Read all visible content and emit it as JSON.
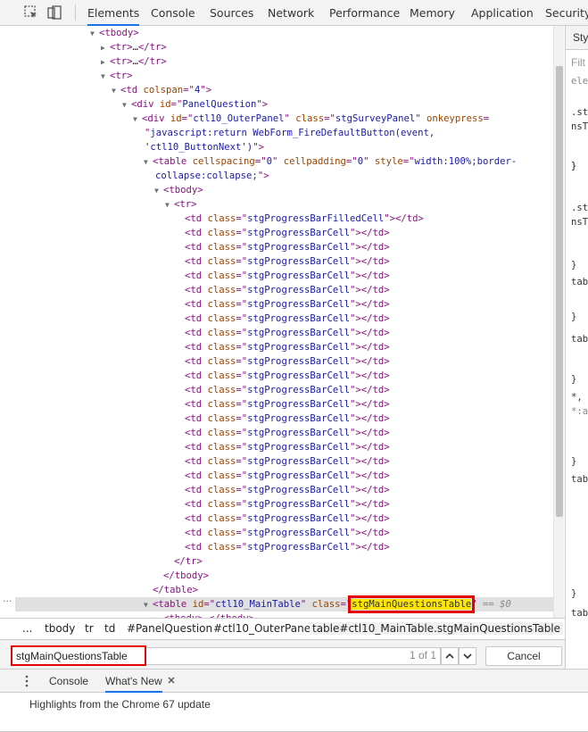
{
  "topbar": {
    "tabs": [
      "Elements",
      "Console",
      "Sources",
      "Network",
      "Performance",
      "Memory",
      "Application",
      "Security"
    ],
    "active_tab": "Elements"
  },
  "tree": {
    "lines": [
      {
        "indent": 7,
        "arrow": "open",
        "html": [
          [
            "t",
            "<tbody>"
          ]
        ]
      },
      {
        "indent": 8,
        "arrow": "closed",
        "html": [
          [
            "t",
            "<tr>"
          ],
          [
            "tx",
            "…"
          ],
          [
            "t",
            "</tr>"
          ]
        ]
      },
      {
        "indent": 8,
        "arrow": "closed",
        "html": [
          [
            "t",
            "<tr>"
          ],
          [
            "tx",
            "…"
          ],
          [
            "t",
            "</tr>"
          ]
        ]
      },
      {
        "indent": 8,
        "arrow": "open",
        "html": [
          [
            "t",
            "<tr>"
          ]
        ]
      },
      {
        "indent": 9,
        "arrow": "open",
        "html": [
          [
            "t",
            "<td "
          ],
          [
            "an",
            "colspan"
          ],
          [
            "t",
            "=\""
          ],
          [
            "av",
            "4"
          ],
          [
            "t",
            "\">"
          ]
        ]
      },
      {
        "indent": 10,
        "arrow": "open",
        "html": [
          [
            "t",
            "<div "
          ],
          [
            "an",
            "id"
          ],
          [
            "t",
            "=\""
          ],
          [
            "av",
            "PanelQuestion"
          ],
          [
            "t",
            "\">"
          ]
        ]
      },
      {
        "indent": 11,
        "arrow": "open",
        "html": [
          [
            "t",
            "<div "
          ],
          [
            "an",
            "id"
          ],
          [
            "t",
            "=\""
          ],
          [
            "av",
            "ctl10_OuterPanel"
          ],
          [
            "t",
            "\" "
          ],
          [
            "an",
            "class"
          ],
          [
            "t",
            "=\""
          ],
          [
            "av",
            "stgSurveyPanel"
          ],
          [
            "t",
            "\" "
          ],
          [
            "an",
            "onkeypress"
          ],
          [
            "t",
            "="
          ]
        ]
      },
      {
        "indent": 11,
        "arrow": "none",
        "cont": 1,
        "html": [
          [
            "t",
            "\""
          ],
          [
            "av",
            "javascript:return WebForm_FireDefaultButton(event,"
          ]
        ]
      },
      {
        "indent": 11,
        "arrow": "none",
        "cont": 1,
        "html": [
          [
            "av",
            "'ctl10_ButtonNext')"
          ],
          [
            "t",
            "\">"
          ]
        ]
      },
      {
        "indent": 12,
        "arrow": "open",
        "html": [
          [
            "t",
            "<table "
          ],
          [
            "an",
            "cellspacing"
          ],
          [
            "t",
            "=\""
          ],
          [
            "av",
            "0"
          ],
          [
            "t",
            "\" "
          ],
          [
            "an",
            "cellpadding"
          ],
          [
            "t",
            "=\""
          ],
          [
            "av",
            "0"
          ],
          [
            "t",
            "\" "
          ],
          [
            "an",
            "style"
          ],
          [
            "t",
            "=\""
          ],
          [
            "av",
            "width:100%;border-"
          ]
        ]
      },
      {
        "indent": 12,
        "arrow": "none",
        "cont": 1,
        "html": [
          [
            "av",
            "collapse:collapse;"
          ],
          [
            "t",
            "\">"
          ]
        ]
      },
      {
        "indent": 13,
        "arrow": "open",
        "html": [
          [
            "t",
            "<tbody>"
          ]
        ]
      },
      {
        "indent": 14,
        "arrow": "open",
        "html": [
          [
            "t",
            "<tr>"
          ]
        ]
      },
      {
        "indent": 15,
        "arrow": "none",
        "html": [
          [
            "t",
            "<td "
          ],
          [
            "an",
            "class"
          ],
          [
            "t",
            "=\""
          ],
          [
            "av",
            "stgProgressBarFilledCell"
          ],
          [
            "t",
            "\"></td>"
          ]
        ]
      },
      {
        "indent": 15,
        "arrow": "none",
        "cell": true
      },
      {
        "indent": 15,
        "arrow": "none",
        "cell": true
      },
      {
        "indent": 15,
        "arrow": "none",
        "cell": true
      },
      {
        "indent": 15,
        "arrow": "none",
        "cell": true
      },
      {
        "indent": 15,
        "arrow": "none",
        "cell": true
      },
      {
        "indent": 15,
        "arrow": "none",
        "cell": true
      },
      {
        "indent": 15,
        "arrow": "none",
        "cell": true
      },
      {
        "indent": 15,
        "arrow": "none",
        "cell": true
      },
      {
        "indent": 15,
        "arrow": "none",
        "cell": true
      },
      {
        "indent": 15,
        "arrow": "none",
        "cell": true
      },
      {
        "indent": 15,
        "arrow": "none",
        "cell": true
      },
      {
        "indent": 15,
        "arrow": "none",
        "cell": true
      },
      {
        "indent": 15,
        "arrow": "none",
        "cell": true
      },
      {
        "indent": 15,
        "arrow": "none",
        "cell": true
      },
      {
        "indent": 15,
        "arrow": "none",
        "cell": true
      },
      {
        "indent": 15,
        "arrow": "none",
        "cell": true
      },
      {
        "indent": 15,
        "arrow": "none",
        "cell": true
      },
      {
        "indent": 15,
        "arrow": "none",
        "cell": true
      },
      {
        "indent": 15,
        "arrow": "none",
        "cell": true
      },
      {
        "indent": 15,
        "arrow": "none",
        "cell": true
      },
      {
        "indent": 15,
        "arrow": "none",
        "cell": true
      },
      {
        "indent": 15,
        "arrow": "none",
        "cell": true
      },
      {
        "indent": 15,
        "arrow": "none",
        "cell": true
      },
      {
        "indent": 14,
        "arrow": "none",
        "html": [
          [
            "t",
            "</tr>"
          ]
        ]
      },
      {
        "indent": 13,
        "arrow": "none",
        "html": [
          [
            "t",
            "</tbody>"
          ]
        ]
      },
      {
        "indent": 12,
        "arrow": "none",
        "html": [
          [
            "t",
            "</table>"
          ]
        ]
      },
      {
        "indent": 12,
        "arrow": "open",
        "selected": true,
        "html": [
          [
            "t",
            "<table "
          ],
          [
            "an",
            "id"
          ],
          [
            "t",
            "=\""
          ],
          [
            "av",
            "ctl10_MainTable"
          ],
          [
            "t",
            "\" "
          ],
          [
            "an",
            "class"
          ],
          [
            "t",
            "=\""
          ],
          [
            "hl",
            "stgMainQuestionsTable"
          ],
          [
            "t",
            "\""
          ]
        ],
        "suffix": " == $0"
      },
      {
        "indent": 13,
        "arrow": "closed",
        "html": [
          [
            "t",
            "<tbody>"
          ],
          [
            "tx",
            "…"
          ],
          [
            "t",
            "</tbody>"
          ]
        ]
      }
    ],
    "cell_class": "stgProgressBarCell",
    "ellipsis": "..."
  },
  "styles": {
    "tab_label": "Sty",
    "filter": "Filt",
    "lines": [
      {
        "text": "ele",
        "dim": true
      },
      {
        "text": "}",
        "dim": false
      },
      {
        "text": ".st",
        "dim": false
      },
      {
        "text": "nsT",
        "dim": false
      },
      {
        "text": "}",
        "dim": false
      },
      {
        "text": ".st",
        "dim": false
      },
      {
        "text": "nsT",
        "dim": false
      },
      {
        "text": "}",
        "dim": false
      },
      {
        "text": "tab",
        "dim": false
      },
      {
        "text": "}",
        "dim": false
      },
      {
        "text": "tab",
        "dim": false
      },
      {
        "text": "}",
        "dim": false
      },
      {
        "text": "*,",
        "dim": false
      },
      {
        "text": "*:a",
        "dim": true
      },
      {
        "text": "}",
        "dim": false
      },
      {
        "text": "tab",
        "dim": false
      },
      {
        "text": "}",
        "dim": false
      },
      {
        "text": "tab",
        "dim": false
      }
    ]
  },
  "breadcrumbs": [
    "...",
    "tbody",
    "tr",
    "td",
    "#PanelQuestion",
    "#ctl10_OuterPanel",
    "table#ctl10_MainTable.stgMainQuestionsTable"
  ],
  "search": {
    "value": "stgMainQuestionsTable",
    "count": "1 of 1",
    "cancel_label": "Cancel"
  },
  "drawer": {
    "tabs": [
      "Console",
      "What's New"
    ],
    "active_tab": "What's New",
    "body_text": "Highlights from the Chrome 67 update"
  },
  "colors": {
    "tag": "#881280",
    "attr_name": "#994500",
    "attr_value": "#1a1aa6",
    "highlight": "#ffe600",
    "highlight_border": "#e50000",
    "active_tab": "#1a73e8"
  }
}
